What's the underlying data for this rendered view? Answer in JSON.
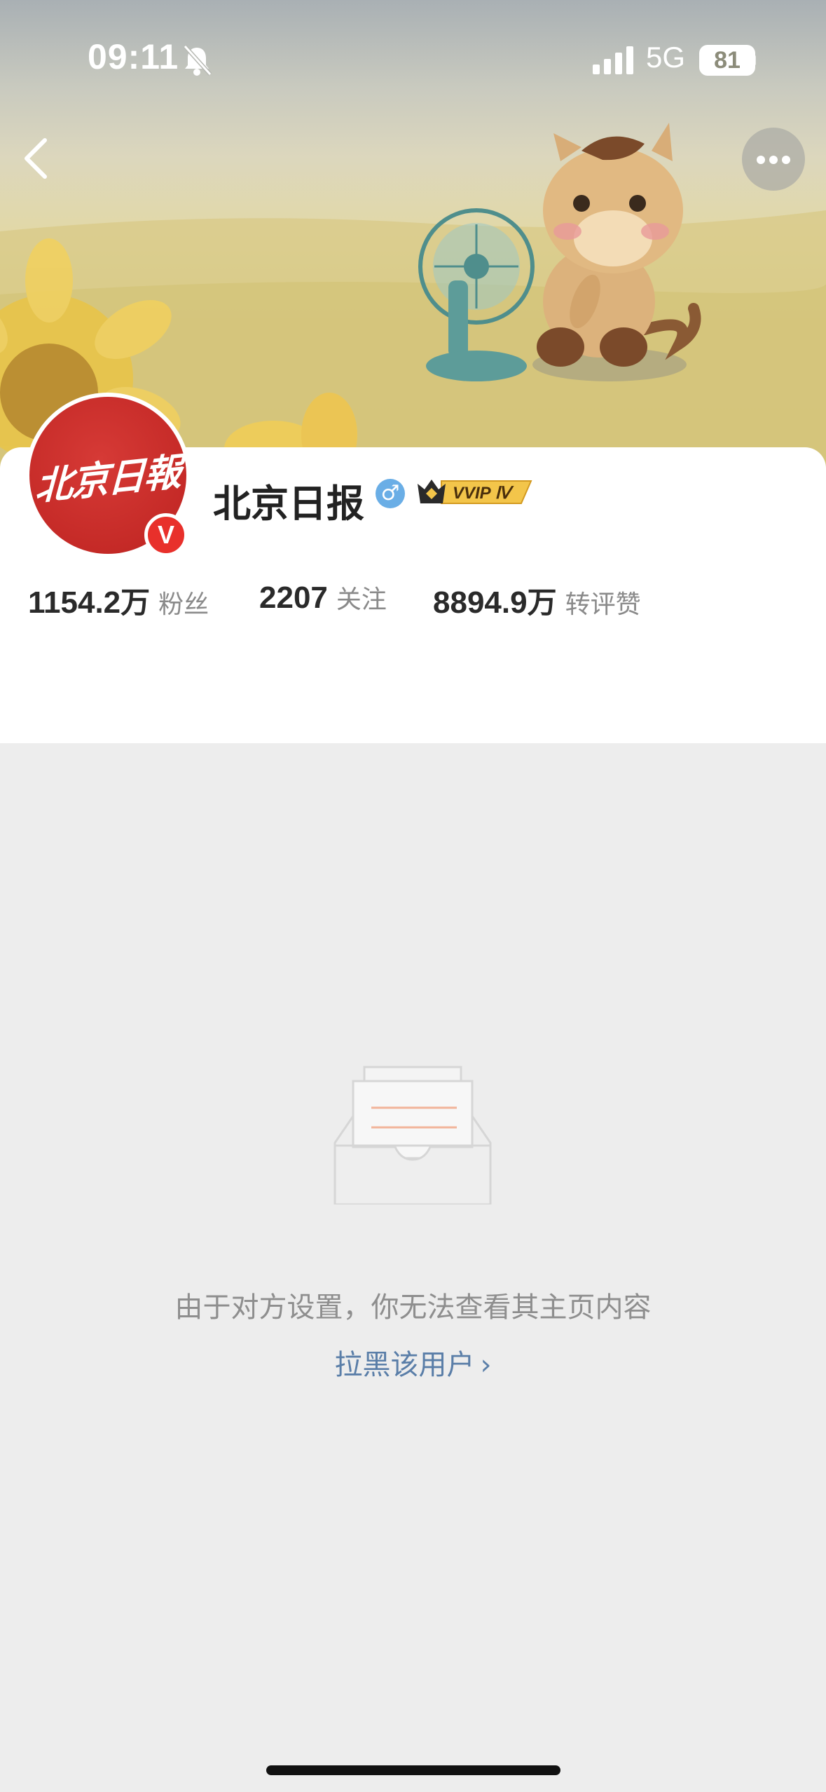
{
  "status_bar": {
    "time": "09:11",
    "network": "5G",
    "battery": "81",
    "icons": [
      "bell-off-icon",
      "signal-icon",
      "battery-icon"
    ]
  },
  "nav": {
    "back_icon": "chevron-left-icon",
    "more_icon": "more-horizontal-icon"
  },
  "profile": {
    "name": "北京日报",
    "avatar_text": "北京日報",
    "verified_mark": "V",
    "gender_symbol": "♂",
    "vip_label": "VVIP Ⅳ",
    "stats": [
      {
        "number": "1154.2",
        "unit": "万",
        "label": "粉丝"
      },
      {
        "number": "2207",
        "unit": "",
        "label": "关注"
      },
      {
        "number": "8894.9",
        "unit": "万",
        "label": "转评赞"
      }
    ]
  },
  "empty_state": {
    "message": "由于对方设置，你无法查看其主页内容",
    "block_link": "拉黑该用户",
    "link_chevron": "›"
  },
  "colors": {
    "avatar_red": "#c52a27",
    "verified_red": "#e8302b",
    "link_blue": "#5a7ea8",
    "gender_blue": "#6aaee6",
    "vip_gold": "#f3c54a",
    "page_bg": "#ededed"
  }
}
